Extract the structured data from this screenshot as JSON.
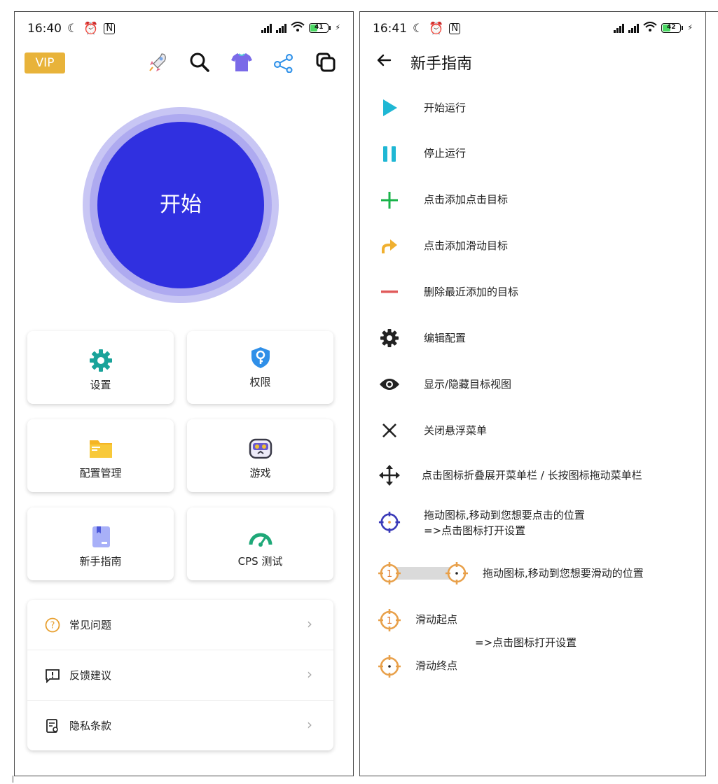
{
  "left": {
    "status": {
      "time": "16:40",
      "battery": "41"
    },
    "vip_label": "VIP",
    "start_label": "开始",
    "cards": [
      {
        "label": "设置",
        "icon": "gear-icon"
      },
      {
        "label": "权限",
        "icon": "shield-key-icon"
      },
      {
        "label": "配置管理",
        "icon": "folder-icon"
      },
      {
        "label": "游戏",
        "icon": "gamepad-icon"
      },
      {
        "label": "新手指南",
        "icon": "book-icon"
      },
      {
        "label": "CPS 测试",
        "icon": "speedometer-icon"
      }
    ],
    "list": [
      {
        "label": "常见问题",
        "icon": "question-icon"
      },
      {
        "label": "反馈建议",
        "icon": "feedback-icon"
      },
      {
        "label": "隐私条款",
        "icon": "document-icon"
      }
    ]
  },
  "right": {
    "status": {
      "time": "16:41",
      "battery": "42"
    },
    "title": "新手指南",
    "items": [
      {
        "label": "开始运行",
        "icon": "play-icon"
      },
      {
        "label": "停止运行",
        "icon": "pause-icon"
      },
      {
        "label": "点击添加点击目标",
        "icon": "plus-icon"
      },
      {
        "label": "点击添加滑动目标",
        "icon": "swipe-arrow-icon"
      },
      {
        "label": "删除最近添加的目标",
        "icon": "minus-icon"
      },
      {
        "label": "编辑配置",
        "icon": "gear-icon"
      },
      {
        "label": "显示/隐藏目标视图",
        "icon": "eye-icon"
      },
      {
        "label": "关闭悬浮菜单",
        "icon": "close-icon"
      },
      {
        "label": "点击图标折叠展开菜单栏 / 长按图标拖动菜单栏",
        "icon": "move-icon"
      }
    ],
    "target_desc_1": "拖动图标,移动到您想要点击的位置",
    "target_desc_2": "=>点击图标打开设置",
    "swipe_desc": "拖动图标,移动到您想要滑动的位置",
    "swipe_start_label": "滑动起点",
    "swipe_open_settings": "=>点击图标打开设置",
    "swipe_end_label": "滑动终点",
    "swipe_start_number": "1"
  },
  "colors": {
    "accent": "#3030e0",
    "vip": "#e8b33a",
    "teal": "#1aa39a",
    "cyan": "#1fb7d4",
    "green": "#19b34a",
    "orange": "#e8a04a",
    "red": "#e05a5a"
  }
}
